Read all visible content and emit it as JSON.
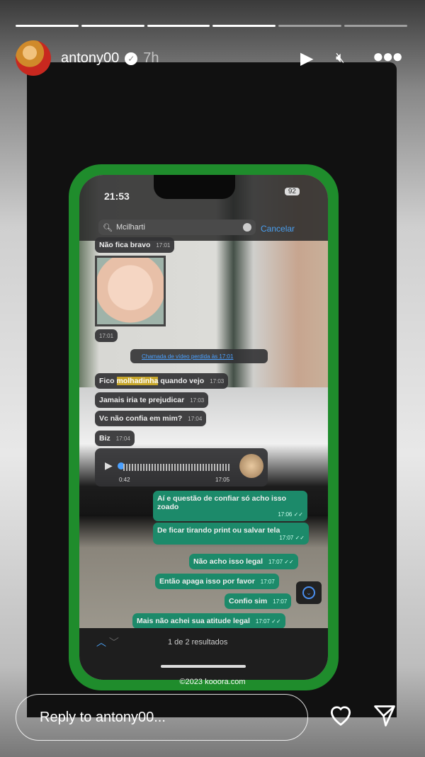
{
  "story": {
    "username": "antony00",
    "verified": true,
    "age": "7h",
    "segments_total": 6,
    "segments_done": 4
  },
  "header": {
    "play_icon": "play-icon",
    "mute_icon": "muted-speaker-icon",
    "more_icon": "more-dots-icon"
  },
  "phone": {
    "time": "21:53",
    "battery": "92",
    "search": {
      "value": "Mcilharti",
      "cancel": "Cancelar"
    },
    "incoming": [
      {
        "text": "Não fica bravo",
        "time": "17:01"
      },
      {
        "time": "17:01"
      },
      {
        "pre": "Fico ",
        "highlight": "molhadinha",
        "post": " quando vejo",
        "time": "17:03"
      },
      {
        "text": "Jamais iria te prejudicar",
        "time": "17:03"
      },
      {
        "text": "Vc não confia em mim?",
        "time": "17:04"
      },
      {
        "text": "Biz",
        "time": "17:04"
      }
    ],
    "call_notice": "Chamada de vídeo perdida às 17:01",
    "audio": {
      "duration": "0:42",
      "time": "17:05"
    },
    "outgoing": [
      {
        "text": "Aí e questão de confiar só acho isso zoado",
        "time": "17:06 ✓✓"
      },
      {
        "text": "De ficar tirando print ou salvar tela",
        "time": "17:07 ✓✓"
      },
      {
        "text": "Não acho isso legal",
        "time": "17:07 ✓✓"
      },
      {
        "text": "Então apaga isso por favor",
        "time": "17:07"
      },
      {
        "text": "Confio sim",
        "time": "17:07"
      },
      {
        "text": "Mais não achei sua atitude legal",
        "time": "17:07 ✓✓"
      }
    ],
    "results": "1 de 2 resultados",
    "accent": "#1c8a6a"
  },
  "watermark": "©2023 kooora.com",
  "reply": {
    "placeholder": "Reply to antony00..."
  }
}
